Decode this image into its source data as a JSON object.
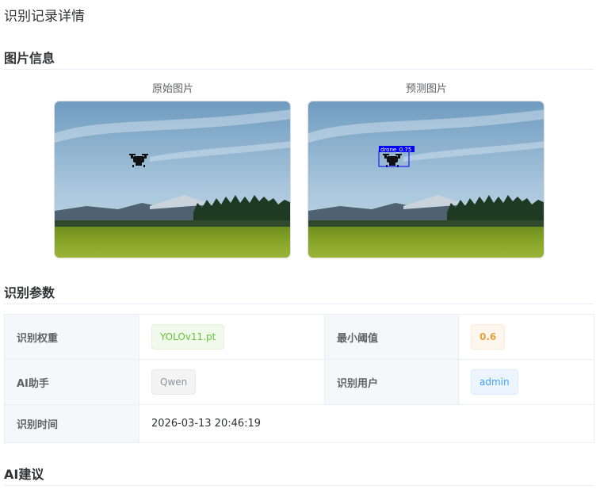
{
  "page": {
    "title": "识别记录详情"
  },
  "sections": {
    "image_info": "图片信息",
    "params": "识别参数",
    "ai_advice": "AI建议"
  },
  "images": {
    "original_caption": "原始图片",
    "predicted_caption": "预测图片",
    "detection_label": "drone_0.75"
  },
  "params": {
    "weight_label": "识别权重",
    "weight_value": "YOLOv11.pt",
    "threshold_label": "最小阈值",
    "threshold_value": "0.6",
    "assistant_label": "AI助手",
    "assistant_value": "Qwen",
    "user_label": "识别用户",
    "user_value": "admin",
    "time_label": "识别时间",
    "time_value": "2026-03-13 20:46:19"
  },
  "colors": {
    "tag_green": "#67c23a",
    "tag_orange": "#e6a23c",
    "tag_gray": "#909399",
    "tag_blue": "#409eff",
    "detection_box": "#0000ff"
  }
}
